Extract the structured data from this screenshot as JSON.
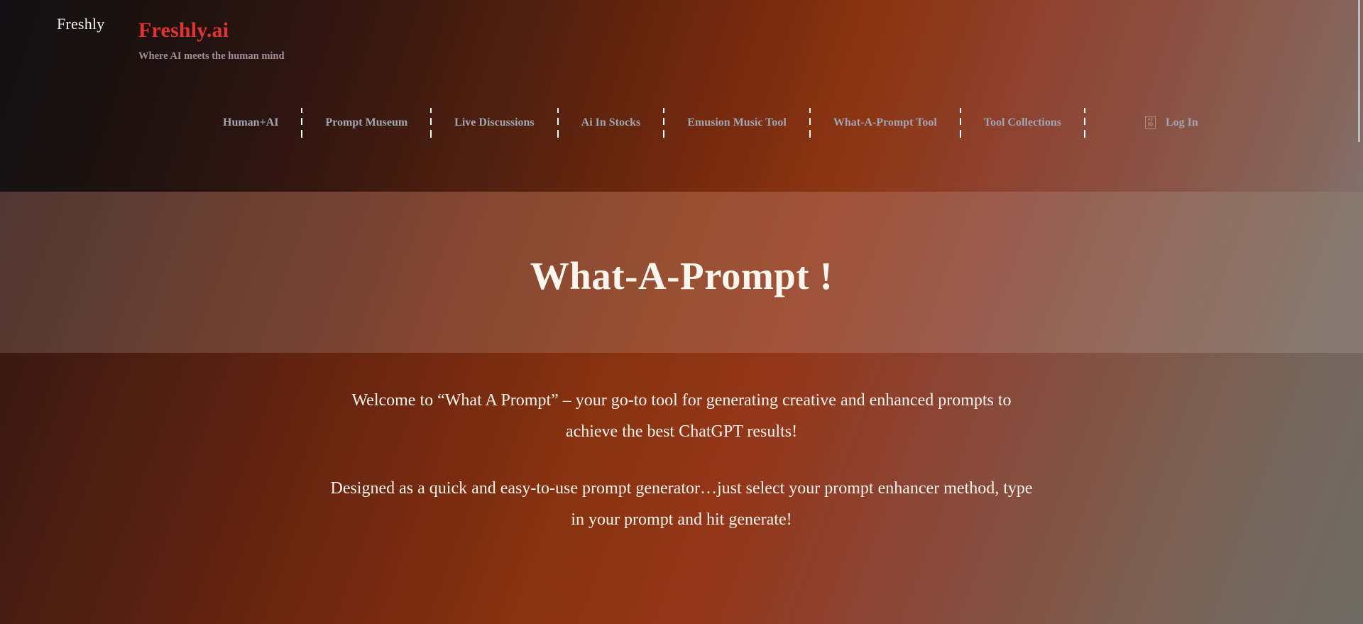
{
  "header": {
    "logo_alt_text": "Freshly",
    "brand_name": "Freshly.ai",
    "tagline": "Where AI meets the human mind",
    "brand_color": "#e03334",
    "tagline_color": "#9d9098"
  },
  "nav": {
    "items": [
      {
        "label": "Human+AI"
      },
      {
        "label": "Prompt Museum"
      },
      {
        "label": "Live Discussions"
      },
      {
        "label": "Ai In Stocks"
      },
      {
        "label": "Emusion Music Tool"
      },
      {
        "label": "What-A-Prompt Tool"
      },
      {
        "label": "Tool Collections"
      }
    ],
    "login": {
      "icon_name": "user-circle-icon",
      "icon_fallback_top": "F2",
      "icon_fallback_bottom": "BD",
      "label": "Log In"
    },
    "link_color": "#9fa6b4"
  },
  "hero": {
    "title": "What-A-Prompt !",
    "title_color": "#fdf6ef"
  },
  "intro": {
    "paragraph_1": "Welcome to “What A Prompt” – your go-to tool for generating creative and enhanced prompts to achieve the best ChatGPT results!",
    "paragraph_2": "Designed as a quick and easy-to-use prompt generator…just select your prompt enhancer method, type in your prompt and hit generate!",
    "text_color": "#fbf4ec"
  },
  "scrollbar": {
    "thumb_color": "#b9bcbd"
  }
}
